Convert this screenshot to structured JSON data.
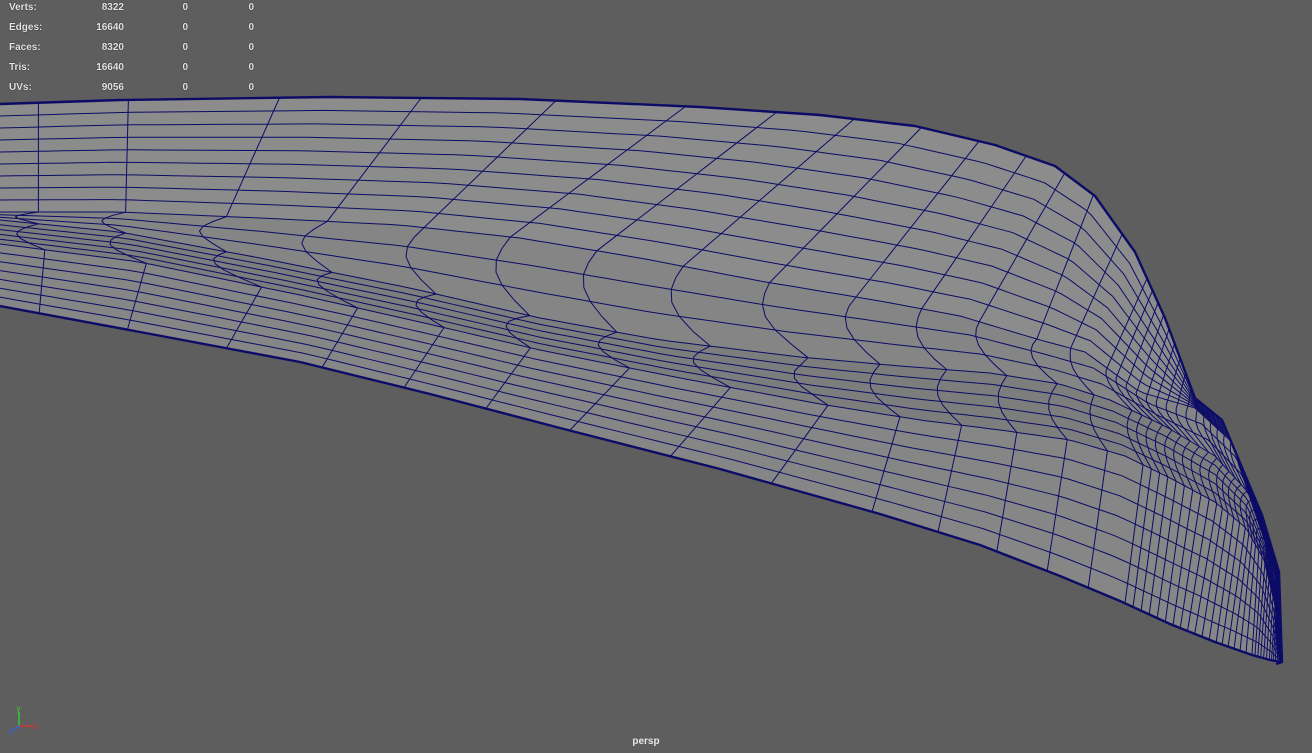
{
  "viewport": {
    "camera": "persp",
    "background_color": "#5e5e5e",
    "wire_color": "#0c0c66",
    "surface_color": "#8c8c8c"
  },
  "hud": {
    "rows": [
      {
        "label": "Verts:",
        "v1": "8322",
        "v2": "0",
        "v3": "0"
      },
      {
        "label": "Edges:",
        "v1": "16640",
        "v2": "0",
        "v3": "0"
      },
      {
        "label": "Faces:",
        "v1": "8320",
        "v2": "0",
        "v3": "0"
      },
      {
        "label": "Tris:",
        "v1": "16640",
        "v2": "0",
        "v3": "0"
      },
      {
        "label": "UVs:",
        "v1": "9056",
        "v2": "0",
        "v3": "0"
      }
    ]
  },
  "axis": {
    "icon": "axis-gizmo-icon",
    "x_label": "x",
    "y_label": "y",
    "z_label": "z",
    "x_color": "#e03030",
    "y_color": "#30d030",
    "z_color": "#3060ff"
  }
}
